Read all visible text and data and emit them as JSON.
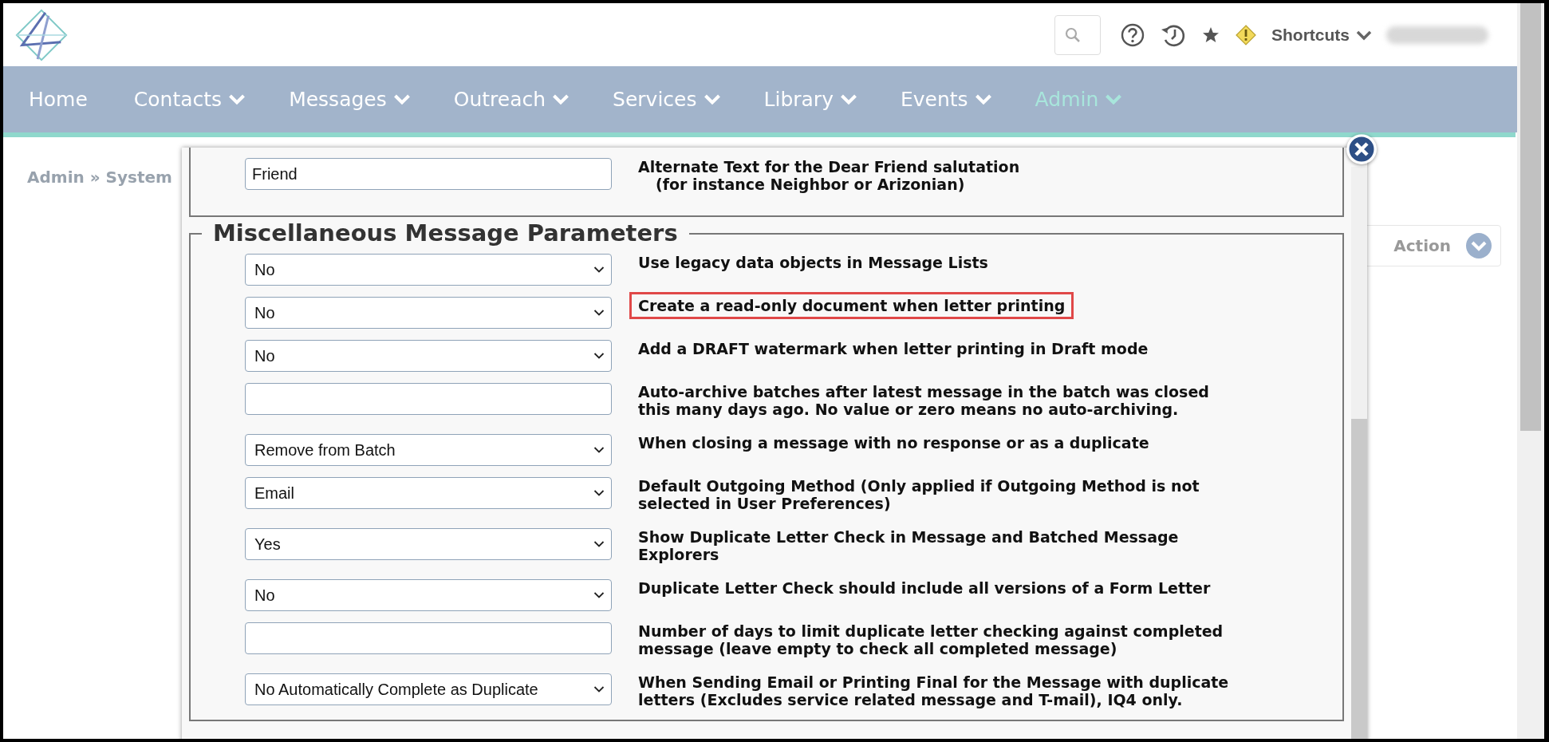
{
  "header": {
    "shortcuts": "Shortcuts"
  },
  "nav": [
    {
      "label": "Home",
      "caret": false,
      "selected": false
    },
    {
      "label": "Contacts",
      "caret": true,
      "selected": false
    },
    {
      "label": "Messages",
      "caret": true,
      "selected": false
    },
    {
      "label": "Outreach",
      "caret": true,
      "selected": false
    },
    {
      "label": "Services",
      "caret": true,
      "selected": false
    },
    {
      "label": "Library",
      "caret": true,
      "selected": false
    },
    {
      "label": "Events",
      "caret": true,
      "selected": false
    },
    {
      "label": "Admin",
      "caret": true,
      "selected": true
    }
  ],
  "breadcrumb": "Admin » System",
  "action_button": "Action",
  "dialog": {
    "salutation": {
      "value": "Friend",
      "label_lines": [
        "Alternate Text for the Dear Friend salutation",
        "(for instance Neighbor or Arizonian)"
      ]
    },
    "section": {
      "title": "Miscellaneous Message Parameters",
      "rows": [
        {
          "kind": "select",
          "value": "No",
          "label_lines": [
            "Use legacy data objects in Message Lists"
          ],
          "highlighted": false
        },
        {
          "kind": "select",
          "value": "No",
          "label_lines": [
            "Create a read-only document when letter printing"
          ],
          "highlighted": true
        },
        {
          "kind": "select",
          "value": "No",
          "label_lines": [
            "Add a DRAFT watermark when letter printing in Draft mode"
          ],
          "highlighted": false
        },
        {
          "kind": "input",
          "value": "",
          "label_lines": [
            "Auto-archive batches after latest message in the batch was closed",
            "this many days ago. No value or zero means no auto-archiving."
          ],
          "highlighted": false
        },
        {
          "kind": "select",
          "value": "Remove from Batch",
          "label_lines": [
            "When closing a message with no response or as a duplicate"
          ],
          "highlighted": false
        },
        {
          "kind": "select",
          "value": "Email",
          "label_lines": [
            "Default Outgoing Method (Only applied if Outgoing Method is not",
            "selected in User Preferences)"
          ],
          "highlighted": false
        },
        {
          "kind": "select",
          "value": "Yes",
          "label_lines": [
            "Show Duplicate Letter Check in Message and Batched Message",
            "Explorers"
          ],
          "highlighted": false
        },
        {
          "kind": "select",
          "value": "No",
          "label_lines": [
            "Duplicate Letter Check should include all versions of a Form Letter"
          ],
          "highlighted": false
        },
        {
          "kind": "input",
          "value": "",
          "label_lines": [
            "Number of days to limit duplicate letter checking against completed",
            "message (leave empty to check all completed message)"
          ],
          "highlighted": false
        },
        {
          "kind": "select",
          "value": "No Automatically Complete as Duplicate",
          "label_lines": [
            "When Sending Email or Printing Final for the Message with duplicate",
            "letters (Excludes service related message and T-mail), IQ4 only."
          ],
          "highlighted": false
        }
      ]
    }
  }
}
